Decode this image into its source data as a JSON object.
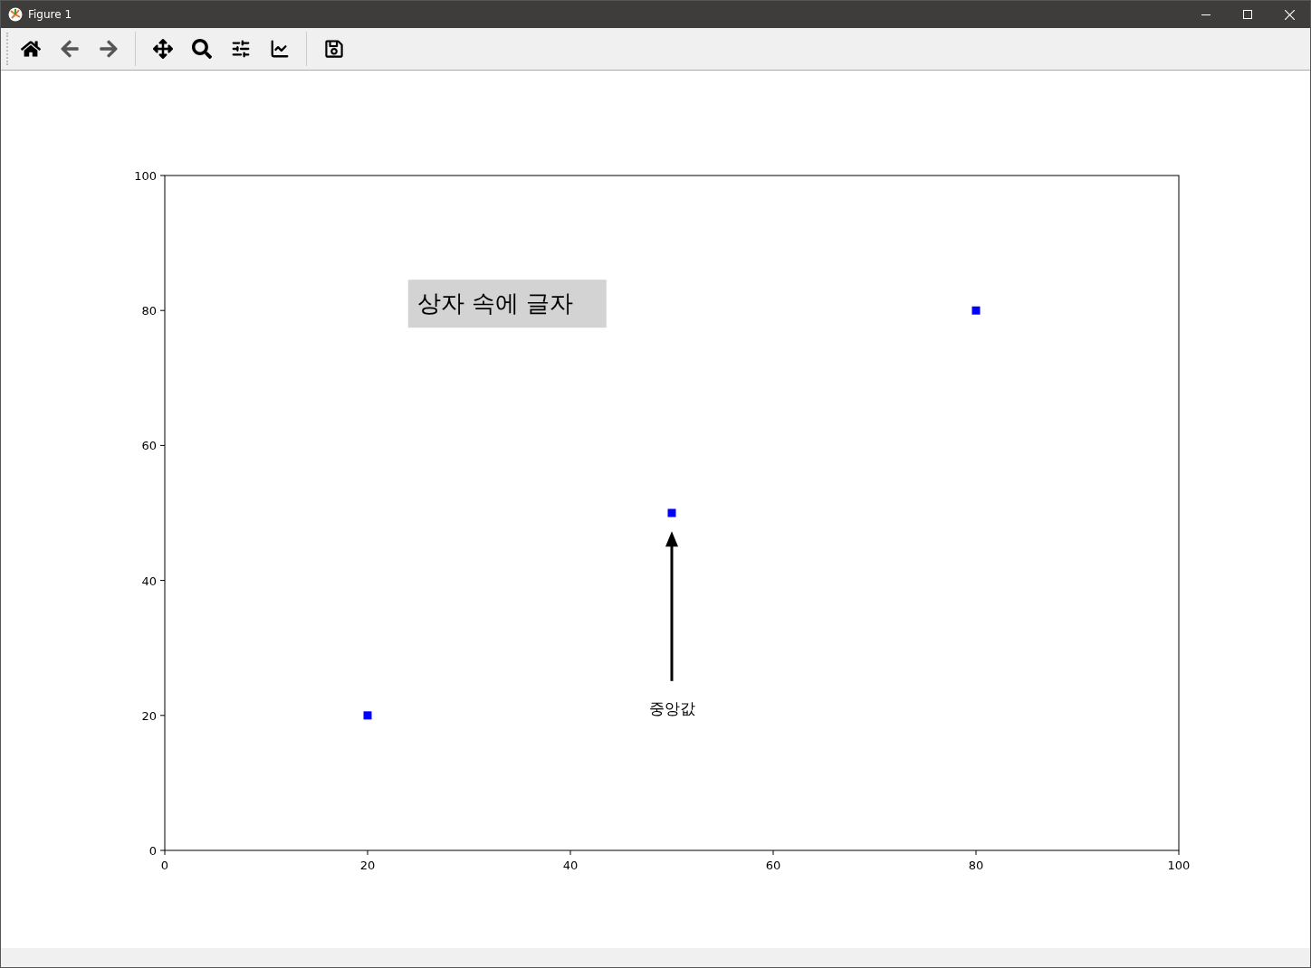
{
  "window": {
    "title": "Figure 1"
  },
  "toolbar": {
    "buttons": [
      {
        "kind": "home"
      },
      {
        "kind": "back"
      },
      {
        "kind": "forward"
      },
      {
        "kind": "pan"
      },
      {
        "kind": "zoom"
      },
      {
        "kind": "subplots"
      },
      {
        "kind": "lines"
      },
      {
        "kind": "save"
      }
    ]
  },
  "figure": {
    "chart_data": {
      "type": "scatter",
      "x": [
        20,
        50,
        80
      ],
      "series": [
        {
          "color": "#0000ff",
          "values": [
            20,
            50,
            80
          ]
        }
      ],
      "xlim": [
        0,
        100
      ],
      "ylim": [
        0,
        100
      ],
      "xticks": [
        0,
        20,
        40,
        60,
        80,
        100
      ],
      "yticks": [
        0,
        20,
        40,
        60,
        80,
        100
      ],
      "annotations": [
        "상자 속에 글자",
        "중앙값"
      ]
    }
  }
}
